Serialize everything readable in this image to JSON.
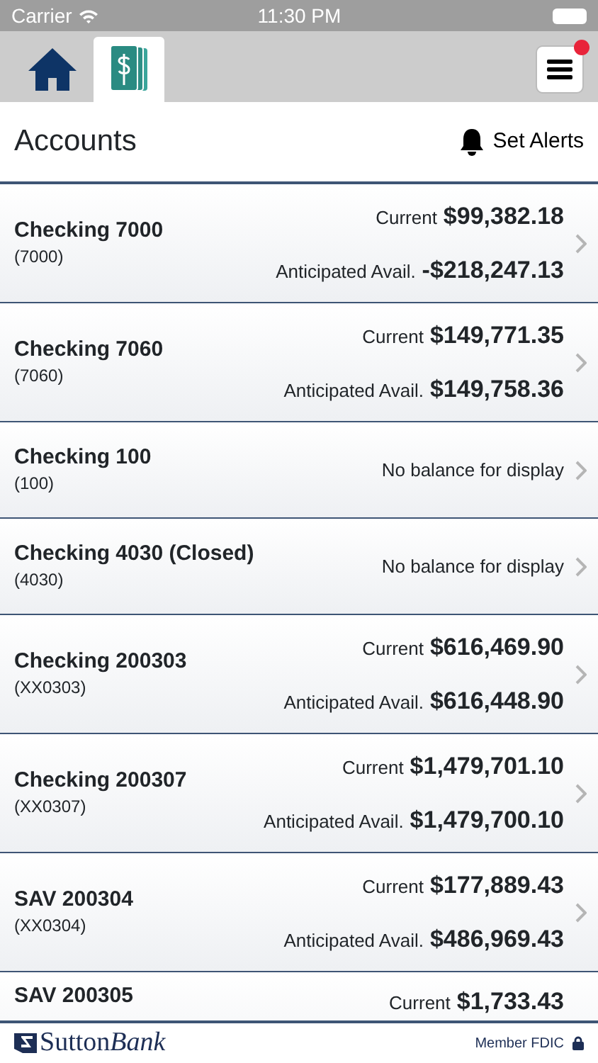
{
  "status_bar": {
    "carrier": "Carrier",
    "time": "11:30 PM"
  },
  "tabs": [
    {
      "kind": "home",
      "selected": false
    },
    {
      "kind": "accounts",
      "selected": true
    }
  ],
  "menu": {
    "notification": true
  },
  "header": {
    "title": "Accounts",
    "alerts_label": "Set Alerts"
  },
  "accounts": [
    {
      "kind": "balances",
      "name": "Checking 7000",
      "number": "(7000)",
      "current_label": "Current",
      "current": "$99,382.18",
      "anticipated_label": "Anticipated Avail.",
      "anticipated": "-$218,247.13"
    },
    {
      "kind": "balances",
      "name": "Checking 7060",
      "number": "(7060)",
      "current_label": "Current",
      "current": "$149,771.35",
      "anticipated_label": "Anticipated Avail.",
      "anticipated": "$149,758.36"
    },
    {
      "kind": "message",
      "name": "Checking 100",
      "number": "(100)",
      "message": "No balance for display"
    },
    {
      "kind": "message",
      "name": "Checking 4030 (Closed)",
      "number": "(4030)",
      "message": "No balance for display"
    },
    {
      "kind": "balances",
      "name": "Checking 200303",
      "number": "(XX0303)",
      "current_label": "Current",
      "current": "$616,469.90",
      "anticipated_label": "Anticipated Avail.",
      "anticipated": "$616,448.90"
    },
    {
      "kind": "balances",
      "name": "Checking 200307",
      "number": "(XX0307)",
      "current_label": "Current",
      "current": "$1,479,701.10",
      "anticipated_label": "Anticipated Avail.",
      "anticipated": "$1,479,700.10"
    },
    {
      "kind": "balances",
      "name": "SAV 200304",
      "number": "(XX0304)",
      "current_label": "Current",
      "current": "$177,889.43",
      "anticipated_label": "Anticipated Avail.",
      "anticipated": "$486,969.43"
    },
    {
      "kind": "partial",
      "name": "SAV 200305",
      "current_label": "Current",
      "current": "$1,733.43"
    }
  ],
  "footer": {
    "logo_first": "Sutton",
    "logo_second": "Bank",
    "fdic": "Member FDIC"
  }
}
